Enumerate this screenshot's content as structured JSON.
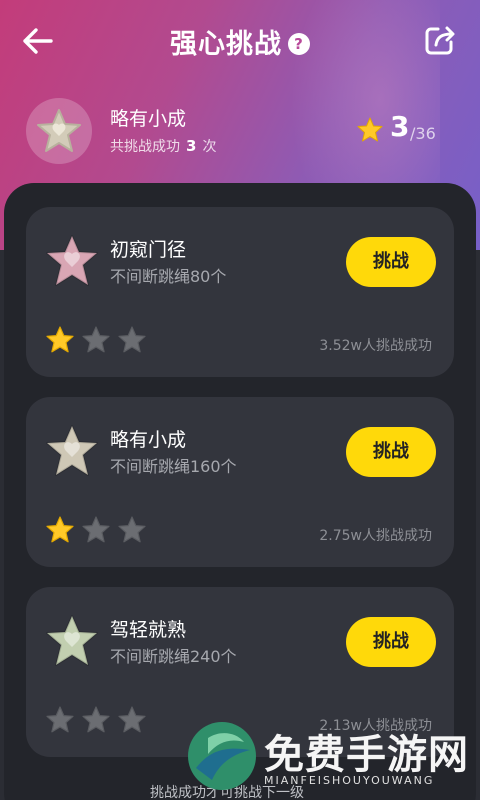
{
  "header": {
    "title": "强心挑战",
    "help_glyph": "?",
    "back_icon": "back-arrow-icon",
    "share_icon": "share-icon"
  },
  "summary": {
    "current_level": "略有小成",
    "total_success_prefix": "共挑战成功",
    "total_success_count": "3",
    "total_success_suffix": "次",
    "stars_earned": "3",
    "stars_total": "/36"
  },
  "challenges": [
    {
      "title": "初窥门径",
      "description": "不间断跳绳80个",
      "button_label": "挑战",
      "success_count": "3.52w人挑战成功",
      "stars_earned": 1,
      "stars_max": 3,
      "medal_color": "#d9a6b4"
    },
    {
      "title": "略有小成",
      "description": "不间断跳绳160个",
      "button_label": "挑战",
      "success_count": "2.75w人挑战成功",
      "stars_earned": 1,
      "stars_max": 3,
      "medal_color": "#cfc8b6"
    },
    {
      "title": "驾轻就熟",
      "description": "不间断跳绳240个",
      "button_label": "挑战",
      "success_count": "2.13w人挑战成功",
      "stars_earned": 0,
      "stars_max": 3,
      "medal_color": "#c2cfb0"
    }
  ],
  "footer_note": "挑战成功才可挑战下一级",
  "watermark": {
    "text": "免费手游网",
    "subtext": "MIANFEISHOUYOUWANG"
  },
  "colors": {
    "accent_button": "#ffd90a",
    "star_filled": "#ffc928",
    "star_empty": "#6b6d72",
    "hero_gradient_start": "#c33c7a",
    "hero_gradient_end": "#7760c8"
  }
}
